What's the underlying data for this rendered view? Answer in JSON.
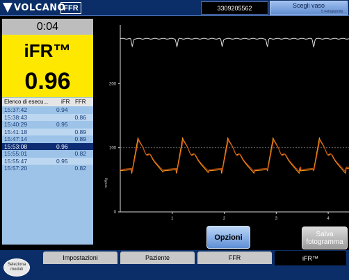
{
  "header": {
    "brand": "VOLCANO",
    "mode": "FFR",
    "patient_id": "3309205562",
    "vessel_button": "Scegli vaso",
    "vessel_sub": "5 Fotogrammi"
  },
  "measure": {
    "timer": "0:04",
    "title": "iFR™",
    "value": "0.96"
  },
  "list": {
    "headers": [
      "Elenco di esecu...",
      "iFR",
      "FFR"
    ],
    "rows": [
      {
        "time": "15:37:42",
        "ifr": "0.94",
        "ffr": ""
      },
      {
        "time": "15:38:43",
        "ifr": "",
        "ffr": "0.86"
      },
      {
        "time": "15:40:29",
        "ifr": "0.95",
        "ffr": ""
      },
      {
        "time": "15:41:18",
        "ifr": "",
        "ffr": "0.89"
      },
      {
        "time": "15:47:14",
        "ifr": "",
        "ffr": "0.89"
      },
      {
        "time": "15:53:08",
        "ifr": "0.96",
        "ffr": "",
        "selected": true
      },
      {
        "time": "15:55:01",
        "ifr": "",
        "ffr": "0.82"
      },
      {
        "time": "15:55:47",
        "ifr": "0.95",
        "ffr": ""
      },
      {
        "time": "15:57:20",
        "ifr": "",
        "ffr": "0.82"
      }
    ]
  },
  "chart": {
    "ylabel": "mmHg",
    "yticks": [
      "0",
      "100",
      "200"
    ],
    "xticks": [
      "1",
      "2",
      "3",
      "4"
    ],
    "colors": {
      "aortic": "#e0e0e0",
      "pa": "#ff9a1a",
      "pd": "#c85010",
      "grid": "#7a7a7a",
      "axis": "#d8d8d8"
    }
  },
  "chart_data": {
    "type": "line",
    "ylabel": "mmHg",
    "xlim": [
      0,
      4.4
    ],
    "ylim": [
      0,
      300
    ],
    "x_ticks": [
      1,
      2,
      3,
      4
    ],
    "y_ticks": [
      0,
      100,
      200
    ],
    "grid": "dashed horizontal at 100",
    "series": [
      {
        "values_desc": "flat trace near 270 with periodic dips",
        "baseline": 270,
        "beats": [
          0.22,
          1.08,
          1.95,
          2.82,
          3.71
        ]
      },
      {
        "values_desc": "pulsatile pressure 60-115",
        "min": 60,
        "max": 115,
        "beats": [
          0.22,
          1.08,
          1.95,
          2.82,
          3.71
        ]
      },
      {
        "values_desc": "pulsatile pressure 62-112",
        "min": 62,
        "max": 112,
        "beats": [
          0.22,
          1.08,
          1.95,
          2.82,
          3.71
        ]
      }
    ]
  },
  "buttons": {
    "opzioni": "Opzioni",
    "salva": "Salva fotogramma",
    "modules": "Seleziona moduli"
  },
  "tabs": [
    {
      "label": "Impostazioni"
    },
    {
      "label": "Paziente"
    },
    {
      "label": "FFR"
    },
    {
      "label": "iFR™",
      "active": true
    }
  ]
}
